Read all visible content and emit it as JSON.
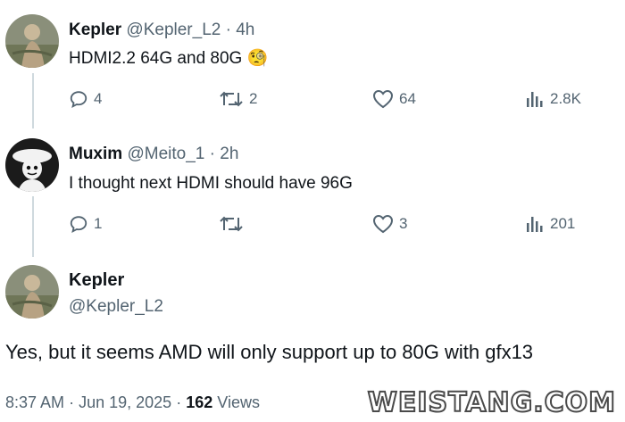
{
  "tweets": [
    {
      "name": "Kepler",
      "handle": "@Kepler_L2",
      "time": "4h",
      "text": "HDMI2.2 64G and 80G",
      "emoji": "🧐",
      "replies": "4",
      "retweets": "2",
      "likes": "64",
      "views": "2.8K"
    },
    {
      "name": "Muxim",
      "handle": "@Meito_1",
      "time": "2h",
      "text": "I thought next HDMI should have 96G",
      "replies": "1",
      "retweets": "",
      "likes": "3",
      "views": "201"
    }
  ],
  "focus": {
    "name": "Kepler",
    "handle": "@Kepler_L2",
    "text": "Yes, but it seems AMD will only support up to 80G with gfx13",
    "time": "8:37 AM",
    "date": "Jun 19, 2025",
    "views_count": "162",
    "views_label": "Views"
  },
  "watermark": "WEISTANG.COM",
  "colors": {
    "text": "#0f1419",
    "secondary": "#536471",
    "thread_line": "#cfd9de"
  },
  "icons": [
    "reply-icon",
    "retweet-icon",
    "like-icon",
    "views-icon"
  ]
}
